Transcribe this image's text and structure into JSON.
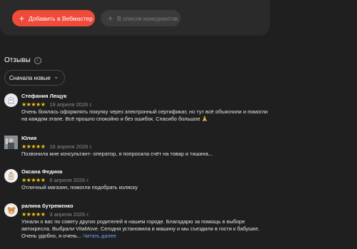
{
  "top_card": {
    "add_button_label": "Добавить в Вебмастер",
    "competitors_button_label": "В список конкурентов"
  },
  "reviews_section": {
    "title": "Отзывы",
    "sort_label": "Сначала новые"
  },
  "reviews": [
    {
      "author": "Стефания Лещук",
      "rating": 5,
      "stars": "★★★★★",
      "date": "19 апреля 2026 г.",
      "text": "Очень боялась оформлять покупку через электронный сертификат, но тут всё объяснили и помогли на каждом этапе. Всё прошло спокойно и без ошибок. Спасибо большое 🙏",
      "more": ""
    },
    {
      "author": "Юлия",
      "rating": 5,
      "stars": "★★★★★",
      "date": "16 апреля 2026 г.",
      "text": "Позвонила мне консультант- оператор, я попросила счёт на товар и тишина...",
      "more": ""
    },
    {
      "author": "Оксана Федина",
      "rating": 5,
      "stars": "★★★★★",
      "date": "6 апреля 2026 г.",
      "text": "Отличный магазин, помогли подобрать коляску",
      "more": ""
    },
    {
      "author": "ралина бутременко",
      "rating": 5,
      "stars": "★★★★★",
      "date": "3 апреля 2026 г.",
      "text": "Узнали о вас по совету других родителей в нашем городе. Благодарю за помощь в выборе автокресла. Выбрали VitaMove. Сегодня установила в машину и мы съездили в гости к бабушке. Очень удобно, я очень...",
      "more": "Читать далее"
    }
  ]
}
